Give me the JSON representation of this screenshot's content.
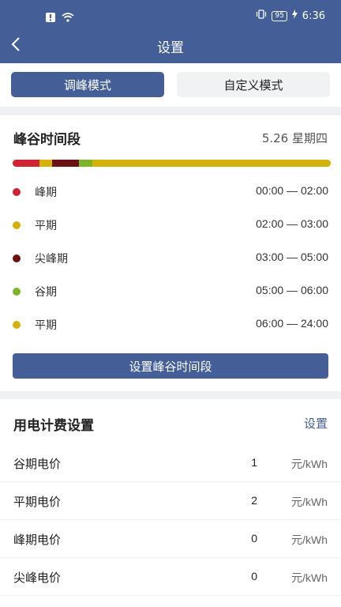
{
  "status_bar": {
    "time": "6:36",
    "battery": "95"
  },
  "header": {
    "title": "设置"
  },
  "modes": {
    "active": "调峰模式",
    "inactive": "自定义模式"
  },
  "peak_valley": {
    "title": "峰谷时间段",
    "date": "5.26 星期四",
    "bar_segments": [
      {
        "start": 0,
        "end": 2,
        "color": "#cf2233"
      },
      {
        "start": 2,
        "end": 3,
        "color": "#d5b10c"
      },
      {
        "start": 3,
        "end": 5,
        "color": "#6b1111"
      },
      {
        "start": 5,
        "end": 6,
        "color": "#7cb628"
      },
      {
        "start": 6,
        "end": 24,
        "color": "#d5b10c"
      }
    ],
    "periods": [
      {
        "name": "峰期",
        "time": "00:00 — 02:00",
        "color": "#cf2233"
      },
      {
        "name": "平期",
        "time": "02:00 — 03:00",
        "color": "#d5b10c"
      },
      {
        "name": "尖峰期",
        "time": "03:00 — 05:00",
        "color": "#6b1111"
      },
      {
        "name": "谷期",
        "time": "05:00 — 06:00",
        "color": "#7cb628"
      },
      {
        "name": "平期",
        "time": "06:00 — 24:00",
        "color": "#d5b10c"
      }
    ],
    "button_label": "设置峰谷时间段"
  },
  "billing": {
    "title": "用电计费设置",
    "action": "设置",
    "rows": [
      {
        "label": "谷期电价",
        "value": "1",
        "unit": "元/kWh"
      },
      {
        "label": "平期电价",
        "value": "2",
        "unit": "元/kWh"
      },
      {
        "label": "峰期电价",
        "value": "0",
        "unit": "元/kWh"
      },
      {
        "label": "尖峰电价",
        "value": "0",
        "unit": "元/kWh"
      }
    ]
  }
}
